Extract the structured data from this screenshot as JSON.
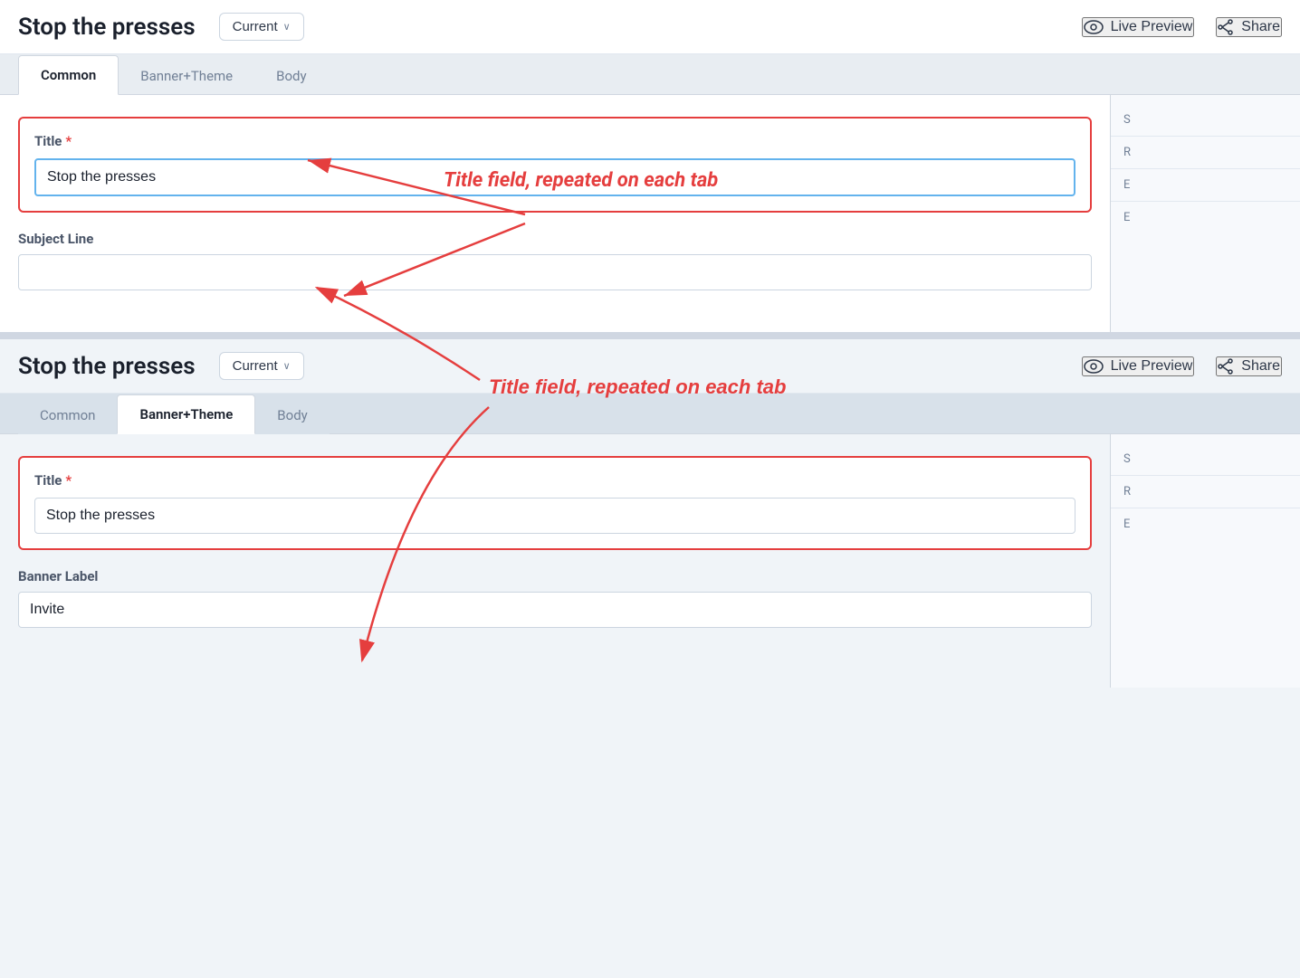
{
  "app": {
    "title": "Stop the presses"
  },
  "panel1": {
    "title": "Stop the presses",
    "version_label": "Current",
    "version_chevron": "∨",
    "live_preview_label": "Live Preview",
    "share_label": "Share",
    "tabs": [
      {
        "id": "common",
        "label": "Common",
        "active": true
      },
      {
        "id": "banner_theme",
        "label": "Banner+Theme",
        "active": false
      },
      {
        "id": "body",
        "label": "Body",
        "active": false
      }
    ],
    "title_field": {
      "label": "Title",
      "required": true,
      "value": "Stop the presses",
      "placeholder": ""
    },
    "subject_field": {
      "label": "Subject Line",
      "value": "",
      "placeholder": ""
    }
  },
  "panel2": {
    "title": "Stop the presses",
    "version_label": "Current",
    "version_chevron": "∨",
    "live_preview_label": "Live Preview",
    "share_label": "Share",
    "tabs": [
      {
        "id": "common",
        "label": "Common",
        "active": false
      },
      {
        "id": "banner_theme",
        "label": "Banner+Theme",
        "active": true
      },
      {
        "id": "body",
        "label": "Body",
        "active": false
      }
    ],
    "title_field": {
      "label": "Title",
      "required": true,
      "value": "Stop the presses",
      "placeholder": ""
    },
    "banner_label_field": {
      "label": "Banner Label",
      "value": "Invite",
      "placeholder": ""
    }
  },
  "annotation": {
    "text": "Title field, repeated on each tab"
  },
  "right_panel": {
    "sections": [
      "S",
      "R",
      "E",
      "E"
    ]
  }
}
